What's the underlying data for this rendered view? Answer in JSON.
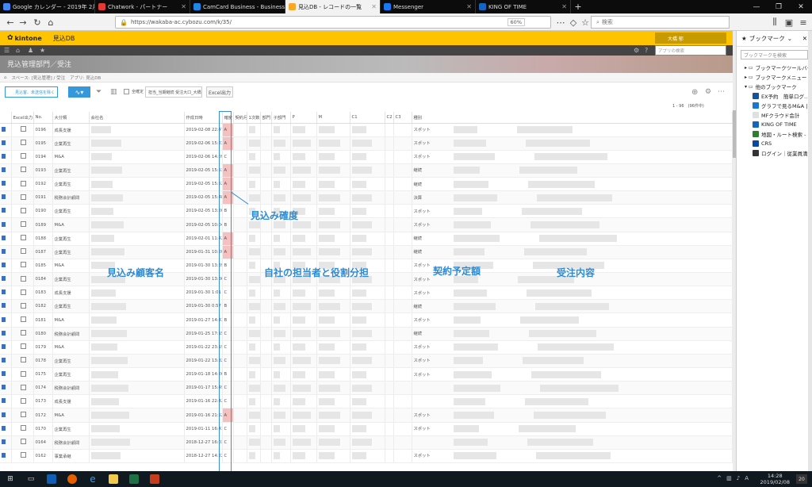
{
  "browser": {
    "tabs": [
      {
        "label": "Google カレンダー - 2019年 2月",
        "color": "#4285f4"
      },
      {
        "label": "Chatwork - パートナー",
        "color": "#e53935"
      },
      {
        "label": "CamCard Business - Business C",
        "color": "#1e88e5"
      },
      {
        "label": "見込DB - レコードの一覧",
        "color": "#f9a825"
      },
      {
        "label": "Messenger",
        "color": "#1877f2"
      },
      {
        "label": "KING OF TIME",
        "color": "#1565c0"
      }
    ],
    "url": "https://wakaba-ac.cybozu.com/k/35/",
    "zoom": "60%",
    "search_placeholder": "検索"
  },
  "bookmarks": {
    "title": "ブックマーク",
    "search_placeholder": "ブックマークを検索",
    "folders": [
      "ブックマークツールバー",
      "ブックマークメニュー",
      "他のブックマーク"
    ],
    "items": [
      {
        "label": "EX予約　簡単ログ...",
        "color": "#1a4f9c"
      },
      {
        "label": "グラフで見るM&A | ...",
        "color": "#1976d2"
      },
      {
        "label": "MFクラウド会計",
        "color": "#e0e0e0"
      },
      {
        "label": "KING OF TIME",
        "color": "#1565c0"
      },
      {
        "label": "地図・ルート検索 - ...",
        "color": "#2e7d32"
      },
      {
        "label": "CRS",
        "color": "#0d47a1"
      },
      {
        "label": "ログイン｜従業員満足...",
        "color": "#333333"
      }
    ]
  },
  "kintone": {
    "logo": "kintone",
    "app_name": "見込DB",
    "user": "大橋 郁",
    "app_search_placeholder": "アプリの検索",
    "space_title": "見込管理部門／受注",
    "breadcrumb": [
      "スペース: [見込管理] / 受注",
      "アプリ: 見込DB"
    ],
    "view": "見込客、未送信を除く",
    "filter_label": "全確定",
    "field_select": "担当_当期継続 受注大口_大橋",
    "export": "Excel出力",
    "record_count": "1 - 96　(96件中)"
  },
  "table": {
    "headers": [
      "",
      "Excel出力",
      "No.",
      "大分類",
      "会社名",
      "作成日時",
      "確度",
      "契約月",
      "1次数",
      "部門",
      "子部門",
      "P",
      "M",
      "C1",
      "C2",
      "C3",
      "種別",
      ""
    ],
    "rows": [
      {
        "no": "0196",
        "cat": "成長支援",
        "date": "2019-02-08 22:47",
        "rank": "A",
        "kind": "スポット"
      },
      {
        "no": "0195",
        "cat": "企業再生",
        "date": "2019-02-06 15:23",
        "rank": "A",
        "kind": "スポット"
      },
      {
        "no": "0194",
        "cat": "M&A",
        "date": "2019-02-06 14:09",
        "rank": "C",
        "kind": "スポット"
      },
      {
        "no": "0193",
        "cat": "企業再生",
        "date": "2019-02-05 15:53",
        "rank": "A",
        "kind": "継続"
      },
      {
        "no": "0192",
        "cat": "企業再生",
        "date": "2019-02-05 15:52",
        "rank": "A",
        "kind": "継続"
      },
      {
        "no": "0191",
        "cat": "税務会計顧問",
        "date": "2019-02-05 15:48",
        "rank": "A",
        "kind": "決算"
      },
      {
        "no": "0190",
        "cat": "企業再生",
        "date": "2019-02-05 13:26",
        "rank": "B",
        "kind": "スポット"
      },
      {
        "no": "0189",
        "cat": "M&A",
        "date": "2019-02-05 10:04",
        "rank": "B",
        "kind": "スポット"
      },
      {
        "no": "0188",
        "cat": "企業再生",
        "date": "2019-02-01 11:42",
        "rank": "A",
        "kind": "継続"
      },
      {
        "no": "0187",
        "cat": "企業再生",
        "date": "2019-01-31 10:20",
        "rank": "A",
        "kind": "継続"
      },
      {
        "no": "0185",
        "cat": "M&A",
        "date": "2019-01-30 13:39",
        "rank": "B",
        "kind": "スポット"
      },
      {
        "no": "0184",
        "cat": "企業再生",
        "date": "2019-01-30 13:36",
        "rank": "C",
        "kind": "スポット"
      },
      {
        "no": "0183",
        "cat": "成長支援",
        "date": "2019-01-30 1:01",
        "rank": "C",
        "kind": "スポット"
      },
      {
        "no": "0182",
        "cat": "企業再生",
        "date": "2019-01-30 0:57",
        "rank": "B",
        "kind": "継続"
      },
      {
        "no": "0181",
        "cat": "M&A",
        "date": "2019-01-27 14:43",
        "rank": "B",
        "kind": "スポット"
      },
      {
        "no": "0180",
        "cat": "税務会計顧問",
        "date": "2019-01-25 17:15",
        "rank": "C",
        "kind": "継続"
      },
      {
        "no": "0179",
        "cat": "M&A",
        "date": "2019-01-22 23:19",
        "rank": "C",
        "kind": "スポット"
      },
      {
        "no": "0178",
        "cat": "企業再生",
        "date": "2019-01-22 13:32",
        "rank": "C",
        "kind": "スポット"
      },
      {
        "no": "0175",
        "cat": "企業再生",
        "date": "2019-01-18 14:26",
        "rank": "B",
        "kind": "スポット"
      },
      {
        "no": "0174",
        "cat": "税務会計顧問",
        "date": "2019-01-17 15:49",
        "rank": "C",
        "kind": ""
      },
      {
        "no": "0173",
        "cat": "成長支援",
        "date": "2019-01-16 22:42",
        "rank": "C",
        "kind": ""
      },
      {
        "no": "0172",
        "cat": "M&A",
        "date": "2019-01-16 21:52",
        "rank": "A",
        "kind": "スポット"
      },
      {
        "no": "0170",
        "cat": "企業再生",
        "date": "2019-01-11 16:43",
        "rank": "C",
        "kind": "スポット"
      },
      {
        "no": "0164",
        "cat": "税務会計顧問",
        "date": "2018-12-27 16:03",
        "rank": "C",
        "kind": ""
      },
      {
        "no": "0162",
        "cat": "事業承継",
        "date": "2018-12-27 14:22",
        "rank": "C",
        "kind": "スポット"
      }
    ]
  },
  "annotations": {
    "rank": "見込み確度",
    "customer": "見込み顧客名",
    "roles": "自社の担当者と役割分担",
    "amount": "契約予定額",
    "content": "受注内容"
  },
  "taskbar": {
    "time": "14:28",
    "date": "2019/02/08",
    "ime": "A",
    "notif": "20"
  }
}
